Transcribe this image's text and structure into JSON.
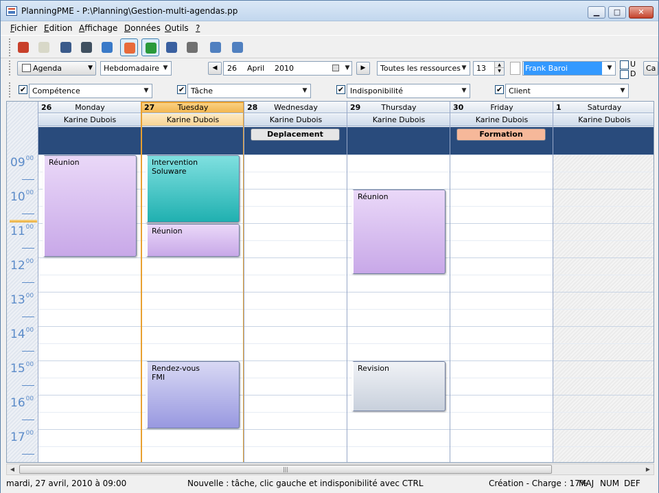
{
  "window": {
    "title": "PlanningPME - P:\\Planning\\Gestion-multi-agendas.pp",
    "buttons": {
      "minimize": "▁",
      "maximize": "□",
      "close": "✕"
    }
  },
  "menu": {
    "items": [
      {
        "label": "Fichier",
        "accel": "F",
        "rest": "ichier"
      },
      {
        "label": "Edition",
        "accel": "E",
        "rest": "dition"
      },
      {
        "label": "Affichage",
        "accel": "A",
        "rest": "ffichage"
      },
      {
        "label": "Données",
        "accel": "D",
        "rest": "onnées"
      },
      {
        "label": "Outils",
        "accel": "O",
        "rest": "utils"
      },
      {
        "label": "?",
        "accel": "?",
        "rest": ""
      }
    ]
  },
  "toolbar": {
    "icons": [
      "users-icon",
      "notepad-icon",
      "user-group-icon",
      "binder-icon",
      "globe-icon",
      "agenda-view-icon",
      "add-task-icon",
      "grid-icon",
      "tools-icon",
      "export-icon",
      "import-icon"
    ],
    "colors": [
      "#c8402a",
      "#d8d8c8",
      "#3a5a8a",
      "#405060",
      "#3a7ac8",
      "#e86a3a",
      "#2a9a3a",
      "#3a60a0",
      "#707070",
      "#5080c0",
      "#5080c0"
    ]
  },
  "controls": {
    "view_button": "Agenda",
    "period": "Hebdomadaire",
    "date_day": "26",
    "date_month": "April",
    "date_year": "2010",
    "resources": "Toutes les ressources",
    "count": "13",
    "user": "Frank Baroi",
    "u_label": "U",
    "d_label": "D",
    "truncated_button": "Ca"
  },
  "filters": [
    {
      "label": "Compétence",
      "checked": "✔"
    },
    {
      "label": "Tâche",
      "checked": "✔"
    },
    {
      "label": "Indisponibilité",
      "checked": "✔"
    },
    {
      "label": "Client",
      "checked": "✔"
    }
  ],
  "calendar": {
    "hours": [
      "09",
      "10",
      "11",
      "12",
      "13",
      "14",
      "15",
      "16",
      "17"
    ],
    "minutes": "00",
    "days": [
      {
        "num": "26",
        "name": "Monday",
        "resource": "Karine Dubois",
        "today": false
      },
      {
        "num": "27",
        "name": "Tuesday",
        "resource": "Karine Dubois",
        "today": true
      },
      {
        "num": "28",
        "name": "Wednesday",
        "resource": "Karine Dubois",
        "today": false,
        "allday": "Deplacement",
        "allday_color": "#e6e6e6"
      },
      {
        "num": "29",
        "name": "Thursday",
        "resource": "Karine Dubois",
        "today": false
      },
      {
        "num": "30",
        "name": "Friday",
        "resource": "Karine Dubois",
        "today": false,
        "allday": "Formation",
        "allday_color": "#f6b89a"
      },
      {
        "num": "1",
        "name": "Saturday",
        "resource": "Karine Dubois",
        "today": false,
        "weekend": true
      }
    ],
    "events": [
      {
        "day": 0,
        "title": "Réunion",
        "start": 9.0,
        "end": 12.0,
        "color_top": "#ead8f8",
        "color_bottom": "#c8a8e8"
      },
      {
        "day": 1,
        "title": "Intervention",
        "title2": "Soluware",
        "start": 9.0,
        "end": 11.0,
        "color_top": "#80e0e0",
        "color_bottom": "#20b0b0"
      },
      {
        "day": 1,
        "title": "Réunion",
        "start": 11.0,
        "end": 12.0,
        "color_top": "#ead8f8",
        "color_bottom": "#c8a8e8"
      },
      {
        "day": 1,
        "title": "Rendez-vous",
        "title2": "FMI",
        "start": 15.0,
        "end": 17.0,
        "color_top": "#d8d8f4",
        "color_bottom": "#9898e0"
      },
      {
        "day": 3,
        "title": "Réunion",
        "start": 10.0,
        "end": 12.5,
        "color_top": "#ead8f8",
        "color_bottom": "#c8a8e8"
      },
      {
        "day": 3,
        "title": "Revision",
        "start": 15.0,
        "end": 16.5,
        "color_top": "#f0f2f6",
        "color_bottom": "#c8d0dc"
      }
    ]
  },
  "status": {
    "datetime": "mardi, 27 avril, 2010 à 09:00",
    "hint": "Nouvelle : tâche, clic gauche et indisponibilité avec CTRL",
    "charge": "Création - Charge : 17%",
    "maj": "MAJ",
    "num": "NUM",
    "def": "DEF"
  }
}
